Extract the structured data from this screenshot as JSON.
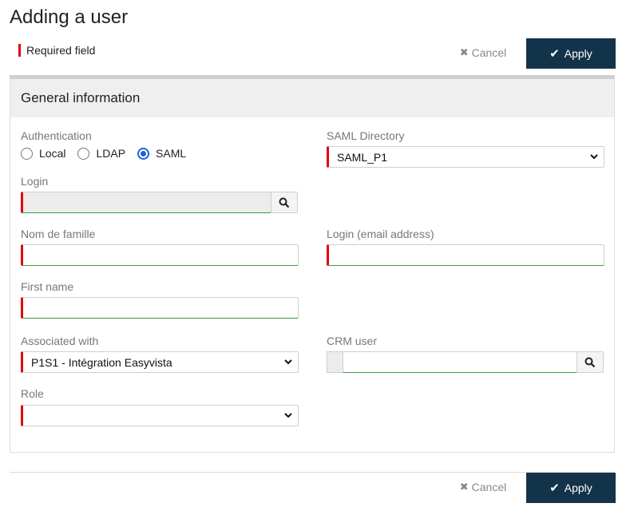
{
  "page": {
    "title": "Adding a user"
  },
  "legend": {
    "required": "Required field"
  },
  "actions": {
    "cancel_label": "Cancel",
    "apply_label": "Apply"
  },
  "section": {
    "title": "General information"
  },
  "form": {
    "authentication": {
      "label": "Authentication",
      "options": [
        "Local",
        "LDAP",
        "SAML"
      ],
      "selected": "SAML"
    },
    "saml_directory": {
      "label": "SAML Directory",
      "value": "SAML_P1"
    },
    "login": {
      "label": "Login",
      "value": ""
    },
    "last_name": {
      "label": "Nom de famille",
      "value": ""
    },
    "email_login": {
      "label": "Login (email address)",
      "value": ""
    },
    "first_name": {
      "label": "First name",
      "value": ""
    },
    "associated_with": {
      "label": "Associated with",
      "value": "P1S1 - Intégration Easyvista"
    },
    "crm_user": {
      "label": "CRM user",
      "value": ""
    },
    "role": {
      "label": "Role",
      "value": ""
    }
  },
  "icons": {
    "cancel": "close-icon",
    "apply": "check-icon",
    "search": "search-icon",
    "dropdown": "chevron-down-icon"
  },
  "colors": {
    "required_marker": "#e3000f",
    "apply_bg": "#13334a",
    "valid_underline": "#3a9b3a",
    "radio_selected": "#1a66d6"
  }
}
